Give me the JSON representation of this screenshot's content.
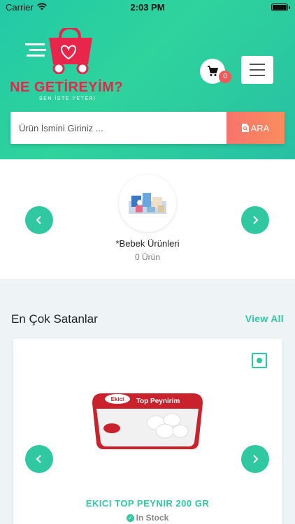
{
  "status_bar": {
    "carrier": "Carrier",
    "time": "2:03 PM"
  },
  "brand": {
    "name": "NE GETİREYİM?",
    "tagline": "SEN İSTE YETER!"
  },
  "cart": {
    "count": "0",
    "icon": "cart-icon"
  },
  "menu": {
    "icon": "hamburger-icon"
  },
  "search": {
    "placeholder": "Ürün İsmini Giriniz ...",
    "button_label": "ARA"
  },
  "category": {
    "name": "*Bebek Ürünleri",
    "count": "0 Ürün"
  },
  "best_sellers": {
    "title": "En Çok Satanlar",
    "view_all": "View All"
  },
  "product": {
    "name": "EKICI TOP PEYNIR 200 GR",
    "stock": "In Stock",
    "brand_label": "Ekici",
    "label": "Top Peynirim"
  },
  "colors": {
    "accent": "#2fc8a0",
    "brand_red": "#e8254a",
    "search_button": "#f97a63"
  }
}
